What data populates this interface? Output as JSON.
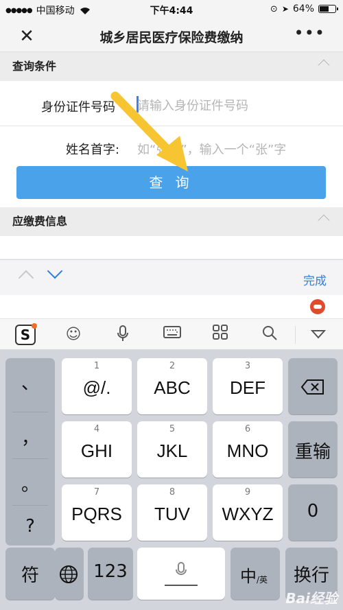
{
  "status_bar": {
    "carrier": "中国移动",
    "time": "下午4:44",
    "battery": "64%",
    "battery_level": 0.64
  },
  "nav": {
    "close": "✕",
    "title": "城乡居民医疗保险费缴纳",
    "more": "•••"
  },
  "query_section": {
    "title": "查询条件",
    "id_label": "身份证件号码",
    "id_placeholder": "请输入身份证件号码",
    "name_label": "姓名首字:",
    "name_placeholder": "如“张三”，输入一个“张”字",
    "button": "查 询"
  },
  "fee_section": {
    "title": "应缴费信息"
  },
  "accessory": {
    "done": "完成"
  },
  "keyboard": {
    "left_punct": [
      "、",
      "，",
      "。",
      "?"
    ],
    "keys": [
      {
        "num": "1",
        "main": "@/."
      },
      {
        "num": "2",
        "main": "ABC"
      },
      {
        "num": "3",
        "main": "DEF"
      },
      {
        "num": "4",
        "main": "GHI"
      },
      {
        "num": "5",
        "main": "JKL"
      },
      {
        "num": "6",
        "main": "MNO"
      },
      {
        "num": "7",
        "main": "PQRS"
      },
      {
        "num": "8",
        "main": "TUV"
      },
      {
        "num": "9",
        "main": "WXYZ"
      }
    ],
    "retype": "重输",
    "zero": "0",
    "symbols": "符",
    "numbers": "123",
    "lang_main": "中",
    "lang_sub": "/英",
    "newline": "换行",
    "logo": "S"
  },
  "watermark": "Bai经验"
}
